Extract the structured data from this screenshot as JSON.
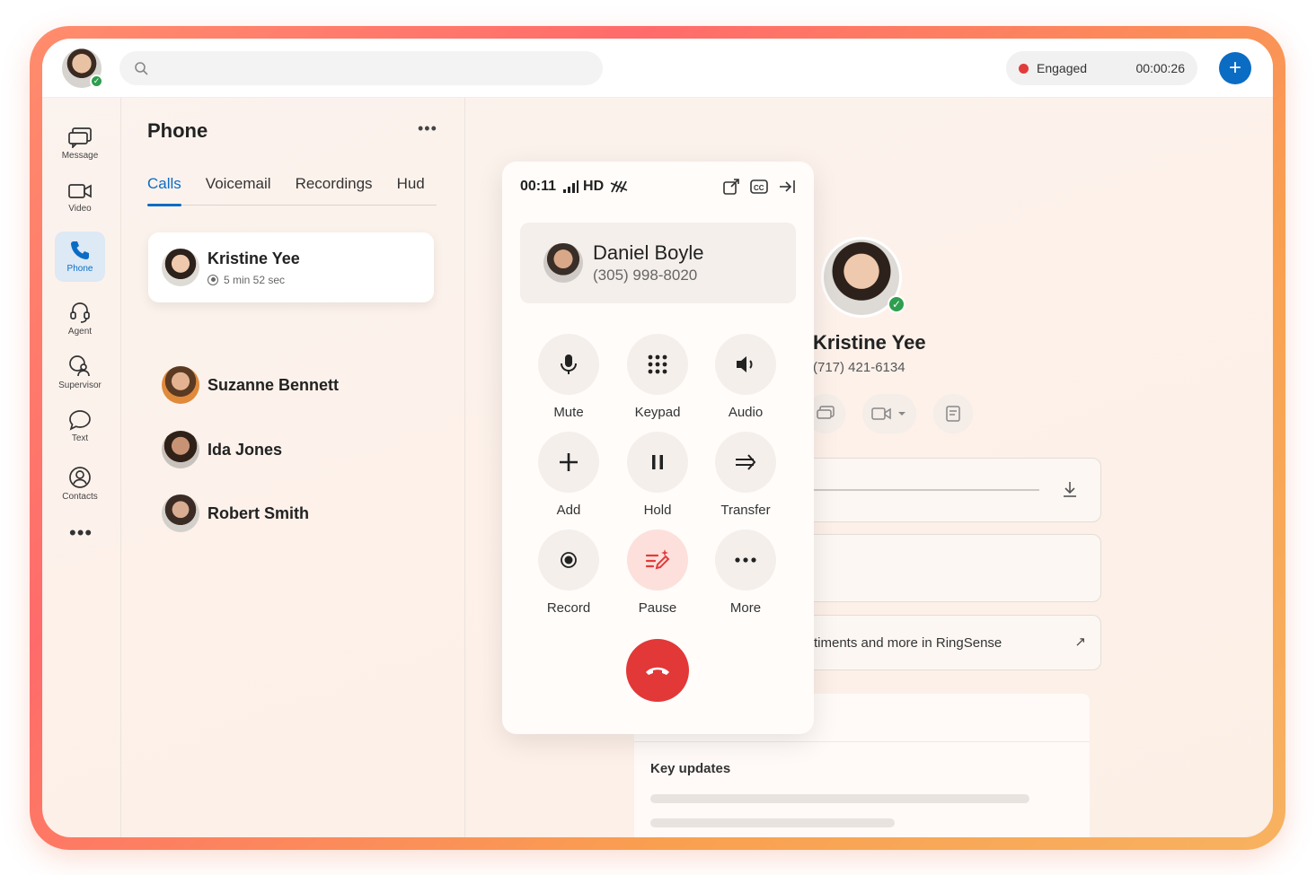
{
  "header": {
    "search_placeholder": "",
    "status_label": "Engaged",
    "status_timer": "00:00:26",
    "add_label": "+"
  },
  "rail": {
    "items": [
      {
        "label": "Message",
        "icon": "message-icon"
      },
      {
        "label": "Video",
        "icon": "video-icon"
      },
      {
        "label": "Phone",
        "icon": "phone-icon",
        "active": true
      },
      {
        "label": "Agent",
        "icon": "headset-icon"
      },
      {
        "label": "Supervisor",
        "icon": "supervisor-icon"
      },
      {
        "label": "Text",
        "icon": "chat-bubble-icon"
      },
      {
        "label": "Contacts",
        "icon": "contacts-icon"
      }
    ],
    "more": "•••"
  },
  "panel": {
    "title": "Phone",
    "menu": "•••",
    "tabs": [
      {
        "label": "Calls",
        "active": true
      },
      {
        "label": "Voicemail"
      },
      {
        "label": "Recordings"
      },
      {
        "label": "Hud"
      }
    ],
    "contacts": [
      {
        "name": "Kristine Yee",
        "sub": "5 min 52 sec",
        "selected": true
      },
      {
        "name": "Suzanne Bennett"
      },
      {
        "name": "Ida Jones"
      },
      {
        "name": "Robert Smith"
      }
    ]
  },
  "call": {
    "duration": "00:11",
    "quality": "HD",
    "caller_name": "Daniel Boyle",
    "caller_number": "(305) 998-8020",
    "buttons": [
      {
        "label": "Mute",
        "icon": "microphone-icon"
      },
      {
        "label": "Keypad",
        "icon": "keypad-icon"
      },
      {
        "label": "Audio",
        "icon": "speaker-icon"
      },
      {
        "label": "Add",
        "icon": "plus-icon"
      },
      {
        "label": "Hold",
        "icon": "pause-icon"
      },
      {
        "label": "Transfer",
        "icon": "transfer-arrow-icon"
      },
      {
        "label": "Record",
        "icon": "record-icon"
      },
      {
        "label": "Pause",
        "icon": "ai-notes-icon"
      },
      {
        "label": "More",
        "icon": "more-dots-icon"
      }
    ]
  },
  "detail": {
    "name": "Kristine Yee",
    "number": "(717) 421-6134",
    "ringsense_text": "timents and more in RingSense",
    "ringsense_arrow": "↗",
    "updates_title": "Key updates"
  },
  "colors": {
    "accent": "#0b6cc4",
    "danger": "#e23838",
    "online": "#2e9e4f",
    "frame_gradient_start": "#ff8d6c",
    "frame_gradient_end": "#f7b260"
  }
}
